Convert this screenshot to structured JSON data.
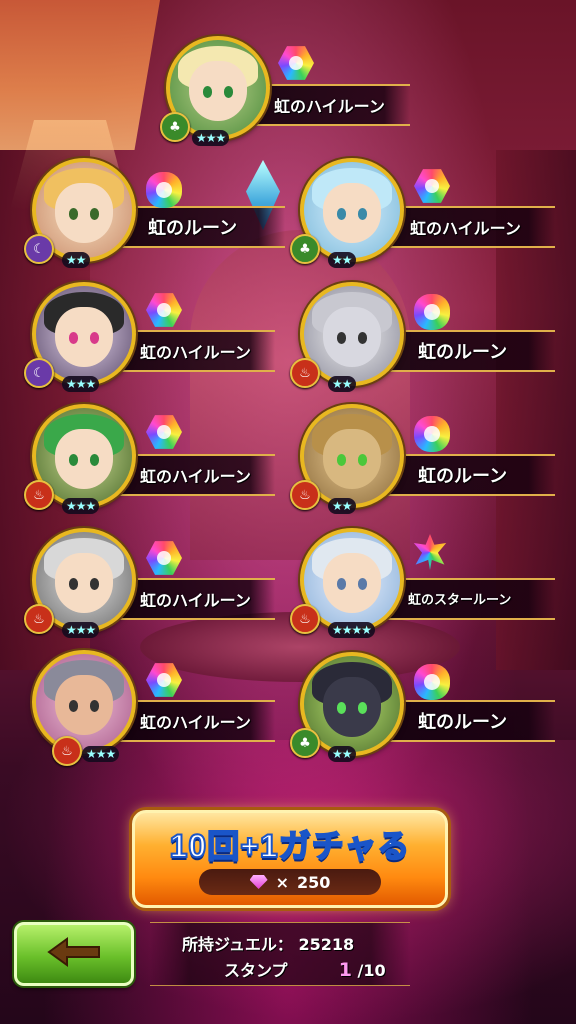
{
  "colors": {
    "accent_gold": "#e0b04a",
    "button_orange": "#ff8a10",
    "back_green": "#6ac02a",
    "stamp_highlight": "#ff9af0"
  },
  "units": [
    {
      "rune": "虹のハイルーン",
      "rune_icon": "rainbow-hex-rune-icon",
      "element_icon": "wood-icon",
      "stars": "★★★"
    },
    {
      "rune": "虹のルーン",
      "rune_icon": "rainbow-rune-icon",
      "element_icon": "dark-icon",
      "stars": "★★"
    },
    {
      "rune": "虹のハイルーン",
      "rune_icon": "rainbow-hex-rune-icon",
      "element_icon": "wood-icon",
      "stars": "★★"
    },
    {
      "rune": "虹のハイルーン",
      "rune_icon": "rainbow-hex-rune-icon",
      "element_icon": "dark-icon",
      "stars": "★★★"
    },
    {
      "rune": "虹のルーン",
      "rune_icon": "rainbow-rune-icon",
      "element_icon": "fire-icon",
      "stars": "★★"
    },
    {
      "rune": "虹のハイルーン",
      "rune_icon": "rainbow-hex-rune-icon",
      "element_icon": "fire-icon",
      "stars": "★★★"
    },
    {
      "rune": "虹のルーン",
      "rune_icon": "rainbow-rune-icon",
      "element_icon": "fire-icon",
      "stars": "★★"
    },
    {
      "rune": "虹のハイルーン",
      "rune_icon": "rainbow-hex-rune-icon",
      "element_icon": "fire-icon",
      "stars": "★★★"
    },
    {
      "rune": "虹のスタールーン",
      "rune_icon": "rainbow-star-rune-icon",
      "element_icon": "fire-icon",
      "stars": "★★★★"
    },
    {
      "rune": "虹のハイルーン",
      "rune_icon": "rainbow-hex-rune-icon",
      "element_icon": "fire-icon",
      "stars": "★★★"
    },
    {
      "rune": "虹のルーン",
      "rune_icon": "rainbow-rune-icon",
      "element_icon": "wood-icon",
      "stars": "★★"
    }
  ],
  "gacha_button": {
    "title": "10回+1ガチャる",
    "cost_symbol": "×",
    "cost": "250"
  },
  "info": {
    "jewel_label": "所持ジュエル：",
    "jewel_value": "25218",
    "stamp_label": "スタンプ",
    "stamp_current": "1",
    "stamp_total": "/10"
  }
}
